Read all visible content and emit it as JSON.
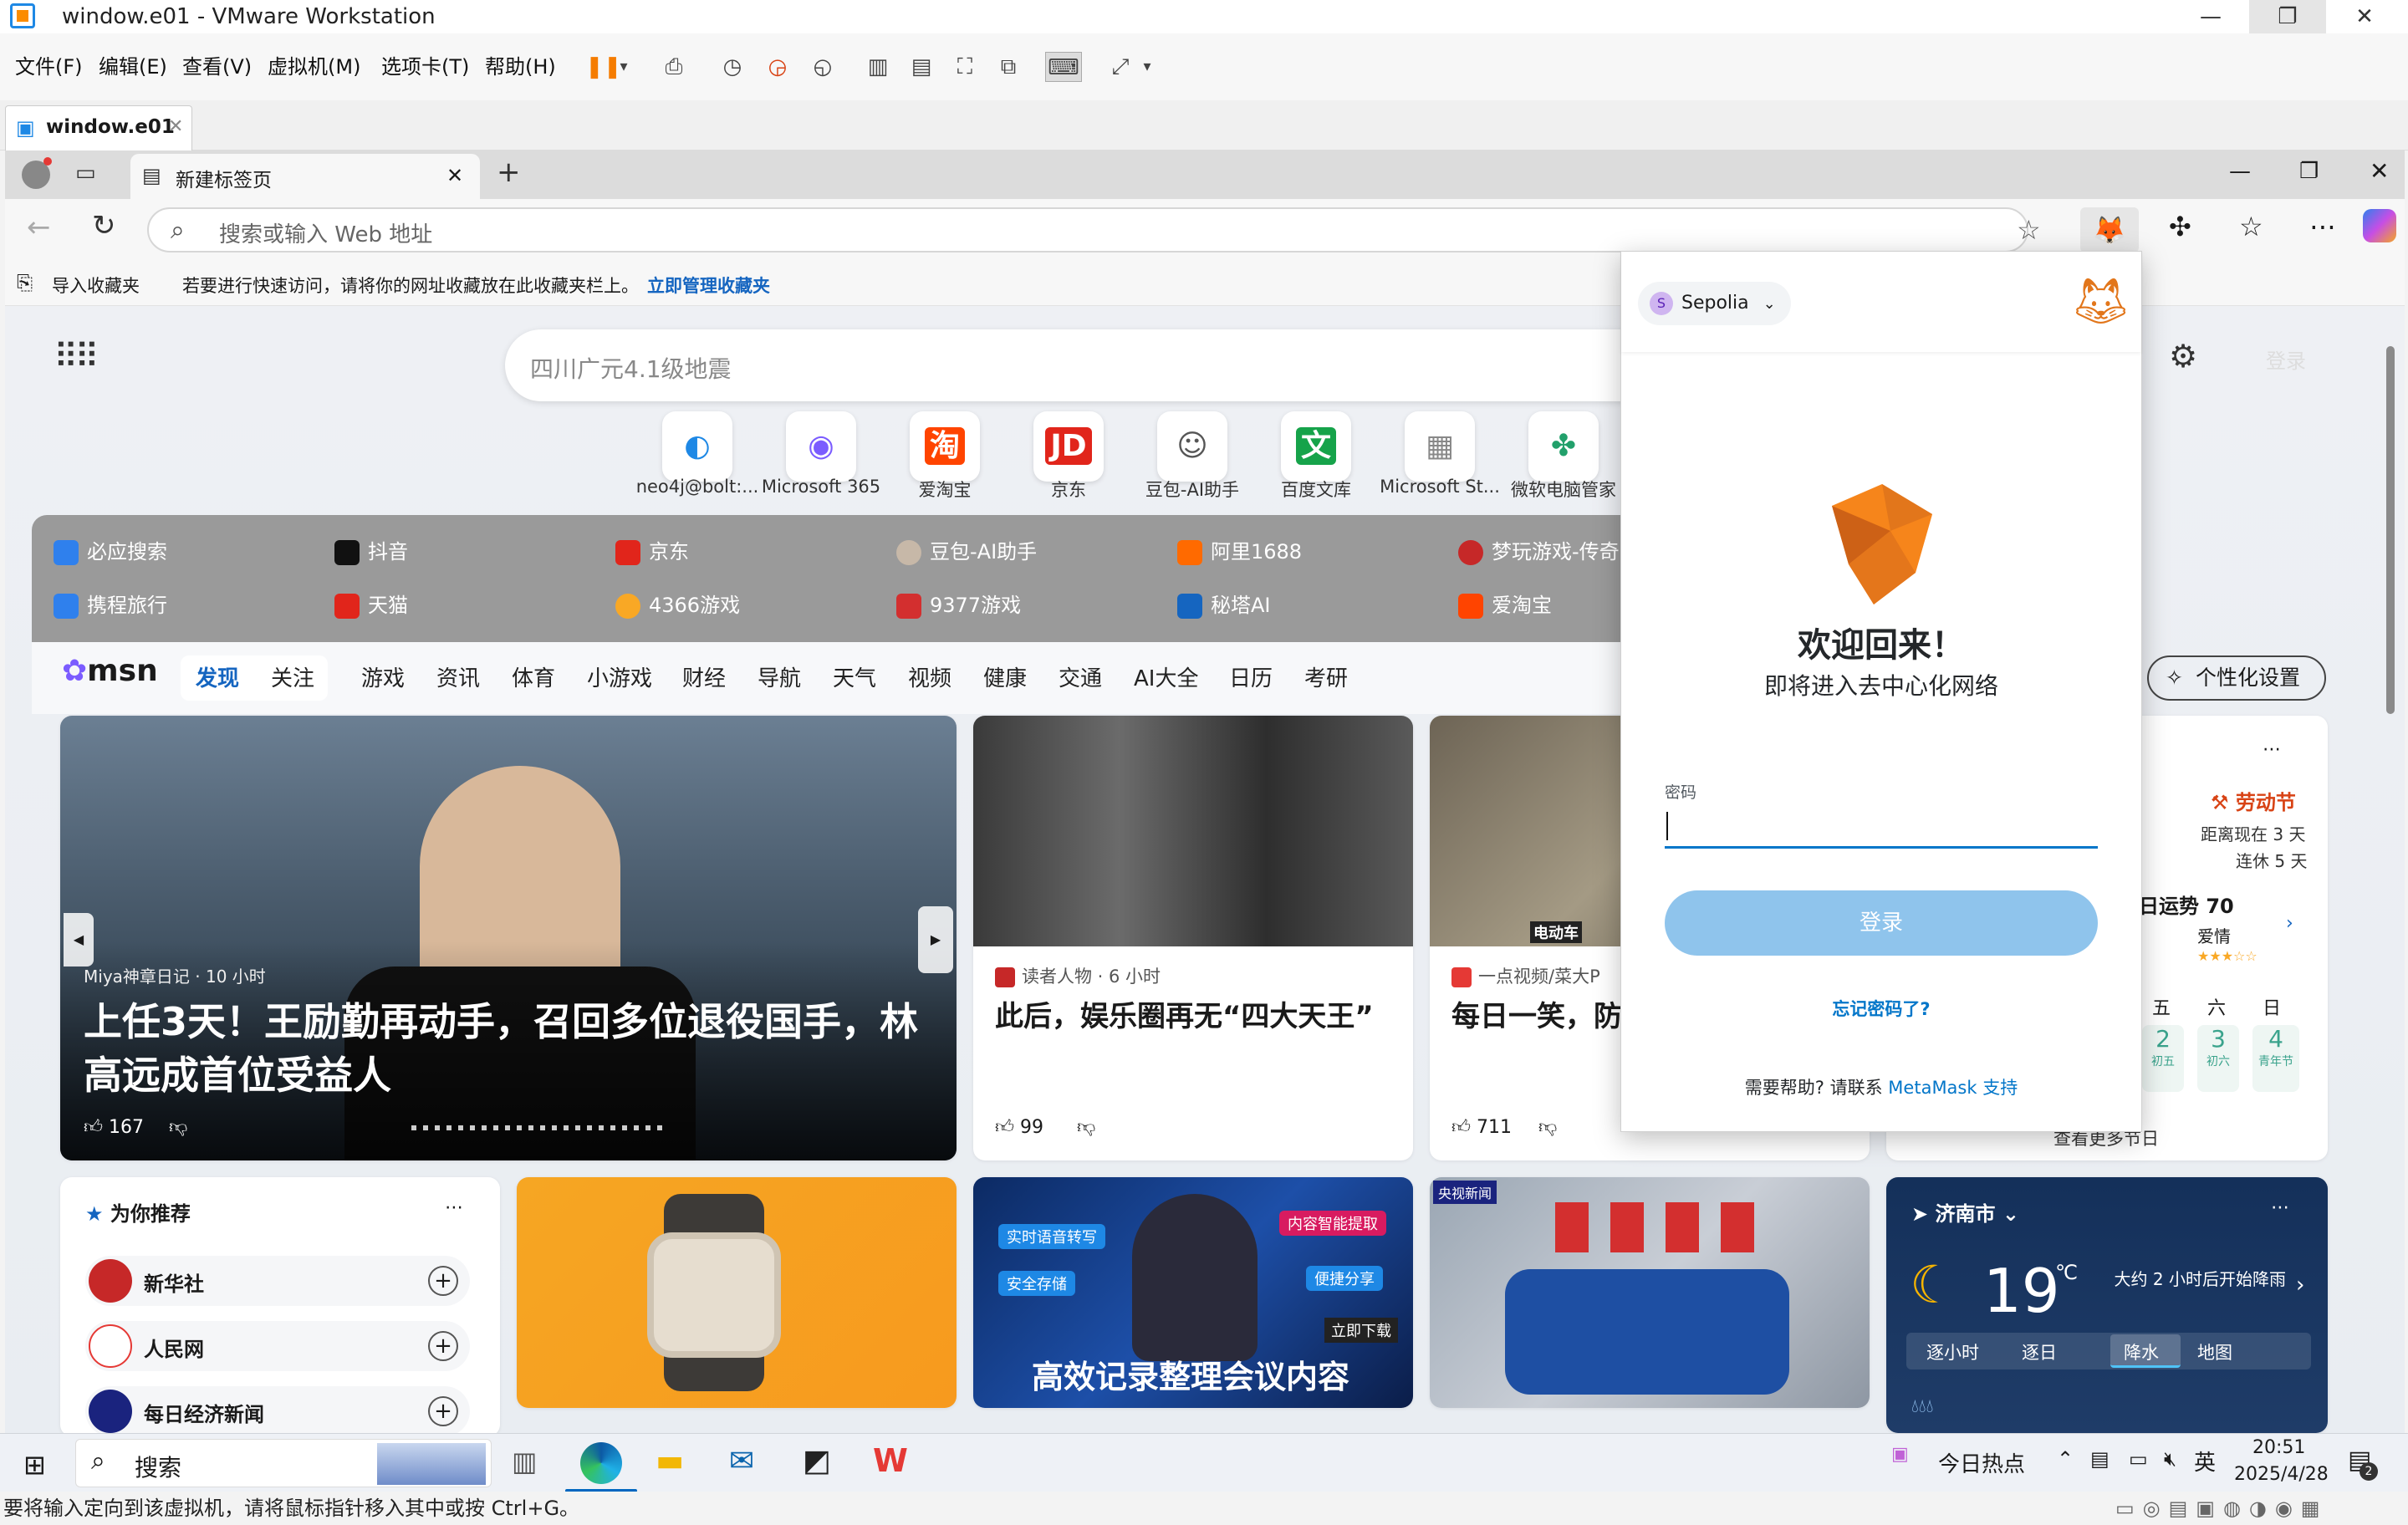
{
  "vmware": {
    "title": "window.e01 - VMware Workstation",
    "menu": [
      "文件(F)",
      "编辑(E)",
      "查看(V)",
      "虚拟机(M)",
      "选项卡(T)",
      "帮助(H)"
    ],
    "tab": "window.e01",
    "status": "要将输入定向到该虚拟机，请将鼠标指针移入其中或按 Ctrl+G。"
  },
  "edge": {
    "tab_title": "新建标签页",
    "address_placeholder": "搜索或输入 Web 地址",
    "fav_import": "导入收藏夹",
    "fav_hint": "若要进行快速访问，请将你的网址收藏放在此收藏夹栏上。",
    "fav_manage": "立即管理收藏夹"
  },
  "newtab": {
    "search_placeholder": "四川广元4.1级地震",
    "login_hint": "登录",
    "quick_links": [
      {
        "label": "neo4j@bolt:...",
        "glyph": "◐",
        "color": "#1e88e5"
      },
      {
        "label": "Microsoft 365",
        "glyph": "◉",
        "color": "#7b5cff"
      },
      {
        "label": "爱淘宝",
        "glyph": "淘",
        "color": "#ff4400"
      },
      {
        "label": "京东",
        "glyph": "JD",
        "color": "#e1251b"
      },
      {
        "label": "豆包-AI助手",
        "glyph": "☺",
        "color": "#555555"
      },
      {
        "label": "百度文库",
        "glyph": "文",
        "color": "#16a34a"
      },
      {
        "label": "Microsoft St...",
        "glyph": "▦",
        "color": "#888888"
      },
      {
        "label": "微软电脑管家",
        "glyph": "✤",
        "color": "#22a06b"
      }
    ],
    "links_row1": [
      "必应搜索",
      "抖音",
      "京东",
      "豆包-AI助手",
      "阿里1688",
      "梦玩游戏-传奇"
    ],
    "links_row2": [
      "携程旅行",
      "天猫",
      "4366游戏",
      "9377游戏",
      "秘塔AI",
      "爱淘宝"
    ],
    "msn": {
      "logo": "msn",
      "tabs": [
        "发现",
        "关注"
      ],
      "nav": [
        "游戏",
        "资讯",
        "体育",
        "小游戏",
        "财经",
        "导航",
        "天气",
        "视频",
        "健康",
        "交通",
        "AI大全",
        "日历",
        "考研"
      ],
      "personalize": "个性化设置"
    },
    "hero": {
      "source": "Miya神章日记 · 10 小时",
      "headline": "上任3天！王励勤再动手，召回多位退役国手，林高远成首位受益人",
      "likes": "167"
    },
    "card2": {
      "source": "读者人物 · 6 小时",
      "headline": "此后，娱乐圈再无“四大天王”",
      "likes": "99"
    },
    "card3": {
      "source": "一点视频/菜大P",
      "headline": "每日一笑，防",
      "likes": "711",
      "overlay": "电动车"
    },
    "calendar": {
      "festival": "劳动节",
      "countdown": "距离现在 3 天",
      "holiday": "连休 5 天",
      "fortune": "日运势 70",
      "fortune_label": "爱情",
      "weekdays": [
        "五",
        "六",
        "日"
      ],
      "days": [
        {
          "d": "2",
          "s": "初五"
        },
        {
          "d": "3",
          "s": "初六"
        },
        {
          "d": "4",
          "s": "青年节"
        }
      ],
      "more": "查看更多节日"
    },
    "recommend": {
      "title": "为你推荐",
      "items": [
        "新华社",
        "人民网",
        "每日经济新闻"
      ]
    },
    "ad_tags": [
      "实时语音转写",
      "安全存储",
      "内容智能提取",
      "便捷分享",
      "立即下载"
    ],
    "ad_headline": "高效记录整理会议内容",
    "news_tag": "央视新闻",
    "weather": {
      "city": "济南市",
      "temp": "19",
      "unit": "℃",
      "forecast": "大约 2 小时后开始降雨",
      "tabs": [
        "逐小时",
        "逐日",
        "降水",
        "地图"
      ]
    }
  },
  "metamask": {
    "network": "Sepolia",
    "network_initial": "S",
    "welcome": "欢迎回来！",
    "subtitle": "即将进入去中心化网络",
    "password_label": "密码",
    "login": "登录",
    "forgot": "忘记密码了?",
    "help_prefix": "需要帮助? 请联系",
    "help_link": "MetaMask 支持"
  },
  "taskbar": {
    "search": "搜索",
    "hot": "今日热点",
    "ime": "英",
    "time": "20:51",
    "date": "2025/4/28",
    "notif": "2"
  }
}
